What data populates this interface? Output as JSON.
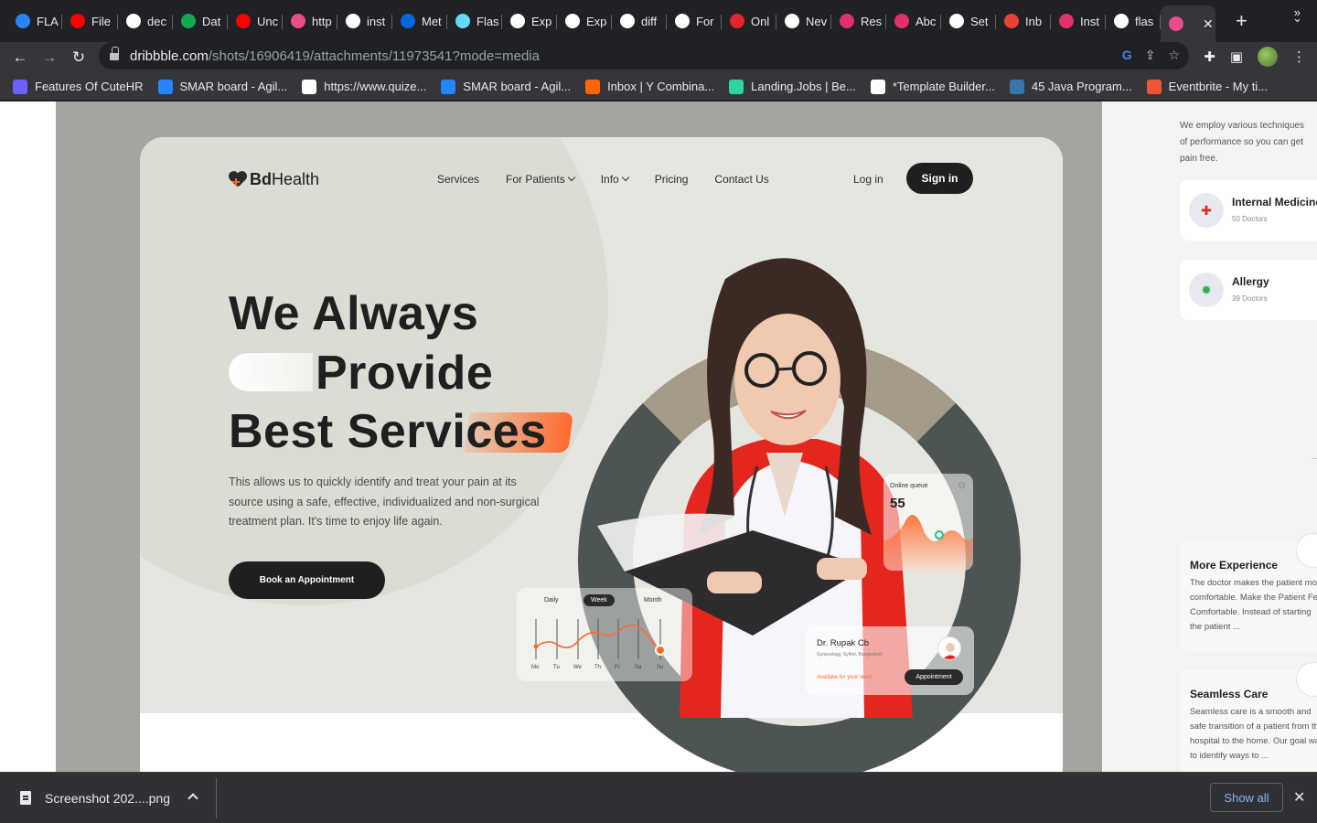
{
  "browser": {
    "tabs": [
      {
        "label": "FLA",
        "icon": "jira-icon",
        "color": "#2684ff"
      },
      {
        "label": "File",
        "icon": "youtube-icon",
        "color": "#ff0000"
      },
      {
        "label": "dec",
        "icon": "github-icon",
        "color": "#ffffff"
      },
      {
        "label": "Dat",
        "icon": "mongodb-icon",
        "color": "#13aa52"
      },
      {
        "label": "Unc",
        "icon": "youtube-icon",
        "color": "#ff0000"
      },
      {
        "label": "http",
        "icon": "dribbble-icon",
        "color": "#ea4c89"
      },
      {
        "label": "inst",
        "icon": "google-icon",
        "color": "#ffffff"
      },
      {
        "label": "Met",
        "icon": "meta-icon",
        "color": "#0668e1"
      },
      {
        "label": "Flas",
        "icon": "react-icon",
        "color": "#61dafb"
      },
      {
        "label": "Exp",
        "icon": "express-icon",
        "color": "#ffffff"
      },
      {
        "label": "Exp",
        "icon": "express-icon",
        "color": "#ffffff"
      },
      {
        "label": "diff",
        "icon": "google-icon",
        "color": "#ffffff"
      },
      {
        "label": "For",
        "icon": "medium-icon",
        "color": "#ffffff"
      },
      {
        "label": "Onl",
        "icon": "scribd-icon",
        "color": "#e3262b"
      },
      {
        "label": "Nev",
        "icon": "chrome-icon",
        "color": "#ffffff"
      },
      {
        "label": "Res",
        "icon": "instagram-icon",
        "color": "#e1306c"
      },
      {
        "label": "Abc",
        "icon": "instagram-icon",
        "color": "#e1306c"
      },
      {
        "label": "Set",
        "icon": "gear-icon",
        "color": "#ffffff"
      },
      {
        "label": "Inb",
        "icon": "gmail-icon",
        "color": "#ea4335"
      },
      {
        "label": "Inst",
        "icon": "instagram-icon",
        "color": "#e1306c"
      },
      {
        "label": "flas",
        "icon": "google-icon",
        "color": "#ffffff"
      }
    ],
    "active_tab": {
      "icon": "dribbble-icon",
      "color": "#ea4c89"
    },
    "url_host": "dribbble.com",
    "url_path": "/shots/16906419/attachments/11973541?mode=media",
    "bookmarks": [
      {
        "label": "Features Of CuteHR",
        "icon": "cutehr-icon",
        "color": "#6c63ff"
      },
      {
        "label": "SMAR board - Agil...",
        "icon": "jira-icon",
        "color": "#2684ff"
      },
      {
        "label": "https://www.quize...",
        "icon": "quizizz-icon",
        "color": "#ffffff"
      },
      {
        "label": "SMAR board - Agil...",
        "icon": "jira-icon",
        "color": "#2684ff"
      },
      {
        "label": "Inbox | Y Combina...",
        "icon": "ycombinator-icon",
        "color": "#ff6600"
      },
      {
        "label": "Landing.Jobs | Be...",
        "icon": "landingjobs-icon",
        "color": "#2fd3a6"
      },
      {
        "label": "*Template Builder...",
        "icon": "wix-icon",
        "color": "#ffffff"
      },
      {
        "label": "45 Java Program...",
        "icon": "python-icon",
        "color": "#3776ab"
      },
      {
        "label": "Eventbrite - My ti...",
        "icon": "eventbrite-icon",
        "color": "#f05537"
      }
    ]
  },
  "page": {
    "logo": {
      "bold": "Bd",
      "rest": "Health"
    },
    "nav": [
      "Services",
      "For Patients",
      "Info",
      "Pricing",
      "Contact Us"
    ],
    "login": "Log in",
    "signin": "Sign in",
    "headline": [
      "We Always",
      "Provide",
      "Best Services"
    ],
    "description": "This allows us to quickly identify and treat your pain at its source using a safe, effective, individualized and non-surgical treatment plan. It's time to enjoy life again.",
    "cta": "Book an Appointment",
    "queue": {
      "title": "Online queue",
      "value": "55"
    },
    "week_card": {
      "tabs": [
        "Daily",
        "Week",
        "Month"
      ],
      "days": [
        "Mo",
        "Tu",
        "We",
        "Th",
        "Fr",
        "Sa",
        "Su"
      ]
    },
    "doctor_card": {
      "name": "Dr. Rupak Cb",
      "location": "Gynecology, Sylhet, Bangladesh",
      "availability": "Availabe for your need",
      "button": "Appointment"
    },
    "accent_color": "#ff6a2c"
  },
  "right_preview": {
    "intro": [
      "We employ various techniques",
      "of performance so you can get",
      "pain free."
    ],
    "specialties": [
      {
        "name": "Internal Medicine",
        "doctors": "50 Doctors"
      },
      {
        "name": "Allergy",
        "doctors": "39 Doctors"
      }
    ],
    "features": [
      {
        "title": "More Experience",
        "text": "The doctor makes the patient more comfortable. Make the Patient Feel Comfortable. Instead of starting the patient ..."
      },
      {
        "title": "Seamless Care",
        "text": "Seamless care is a smooth and safe transition of a patient from the hospital to the home. Our goal was to identify ways to ..."
      }
    ]
  },
  "downloads": {
    "file": "Screenshot 202....png",
    "show_all": "Show all"
  }
}
